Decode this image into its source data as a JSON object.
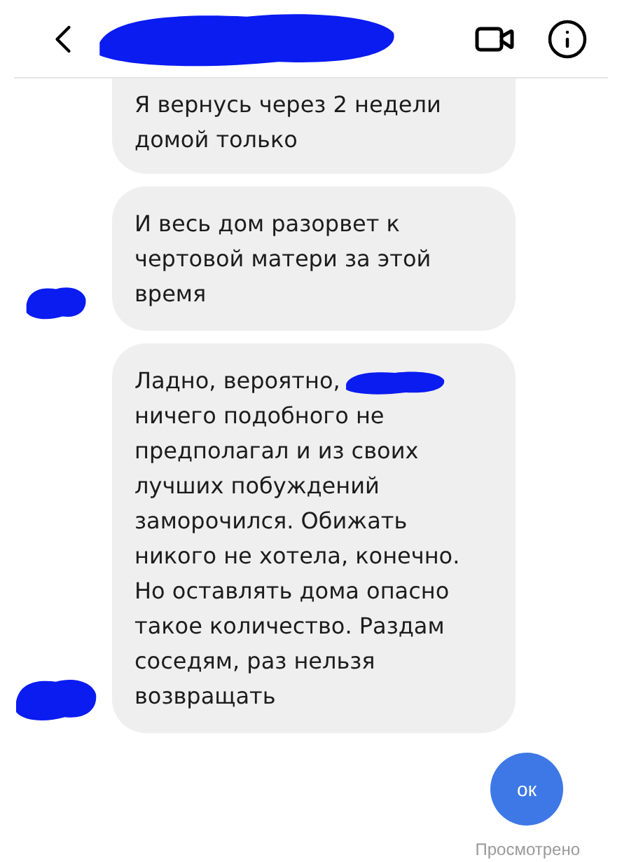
{
  "header": {
    "name_redacted": true
  },
  "messages": [
    {
      "kind": "received",
      "parts": [
        "Я вернусь через 2 недели домой только"
      ],
      "cut_top": true,
      "avatar_redacted": false
    },
    {
      "kind": "received",
      "parts": [
        "И весь дом разорвет к чертовой матери за этой время"
      ],
      "cut_top": false,
      "avatar_redacted": true
    },
    {
      "kind": "received",
      "parts": [
        "Ладно, вероятно,",
        "ничего подобного не предполагал и из своих лучших побуждений заморочился. Обижать никого не хотела, конечно. Но оставлять дома опасно такое количество. Раздам соседям, раз нельзя возвращать"
      ],
      "cut_top": false,
      "avatar_redacted": true
    },
    {
      "kind": "sent",
      "parts": [
        "ок"
      ]
    }
  ],
  "status": "Просмотрено"
}
